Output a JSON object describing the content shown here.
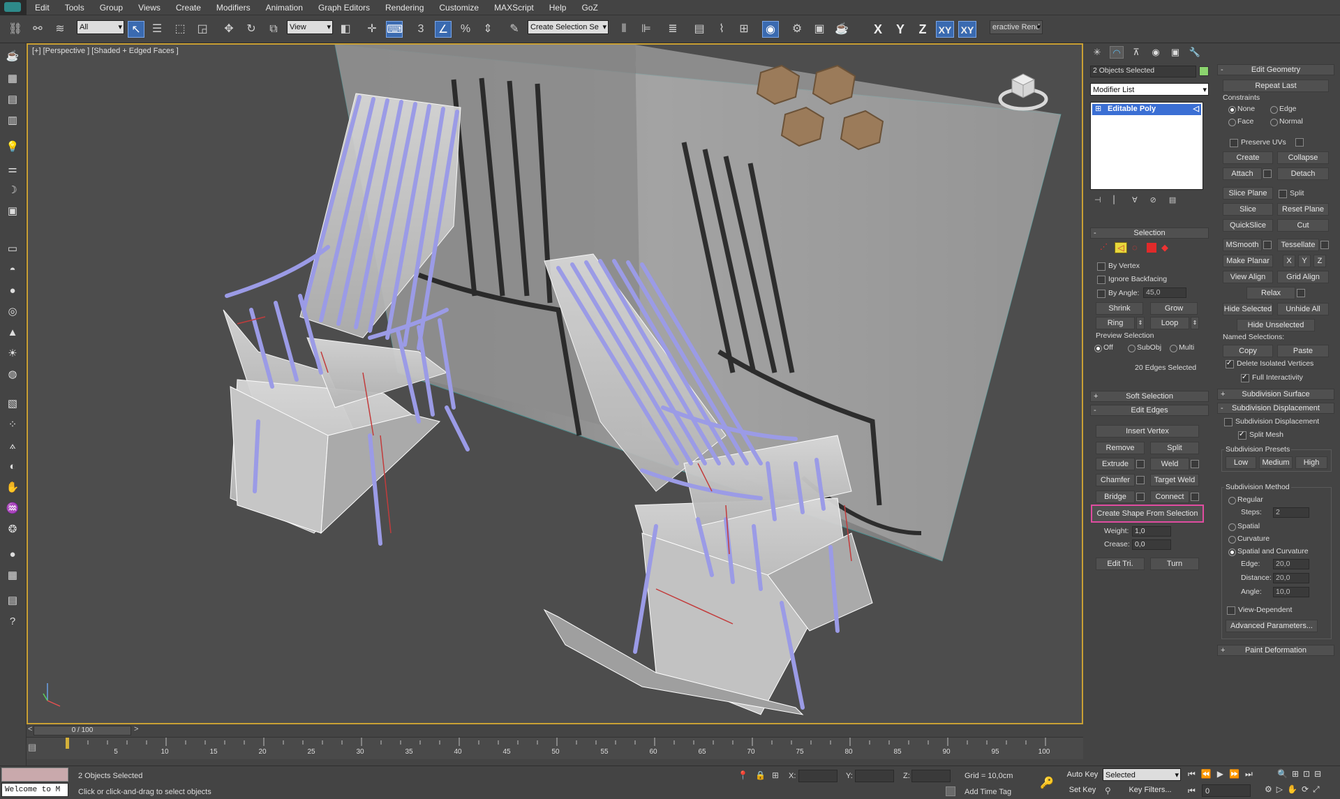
{
  "menu": [
    "Edit",
    "Tools",
    "Group",
    "Views",
    "Create",
    "Modifiers",
    "Animation",
    "Graph Editors",
    "Rendering",
    "Customize",
    "MAXScript",
    "Help",
    "GoZ"
  ],
  "toolbar": {
    "filter_select": "All",
    "refcoord_select": "View",
    "named_selection_select": "Create Selection Se",
    "interactive_render": "eractive Rend",
    "axes": [
      "X",
      "Y",
      "Z",
      "XY",
      "XY"
    ]
  },
  "viewport": {
    "label": "[+] [Perspective ] [Shaded + Edged Faces ]",
    "frame_range": "0 / 100"
  },
  "timeline": {
    "ticks": [
      "5",
      "10",
      "15",
      "20",
      "25",
      "30",
      "35",
      "40",
      "45",
      "50",
      "55",
      "60",
      "65",
      "70",
      "75",
      "80",
      "85",
      "90",
      "95",
      "100"
    ]
  },
  "status": {
    "maxscript_listener": "Welcome to M",
    "selection_info": "2 Objects Selected",
    "prompt": "Click or click-and-drag to select objects",
    "x_label": "X:",
    "y_label": "Y:",
    "z_label": "Z:",
    "grid": "Grid = 10,0cm",
    "add_time_tag": "Add Time Tag",
    "auto_key": "Auto Key",
    "set_key": "Set Key",
    "key_mode": "Selected",
    "key_filters": "Key Filters...",
    "frame": "0"
  },
  "command_panel": {
    "objects_selected": "2 Objects Selected",
    "modifier_list": "Modifier List",
    "stack_item": "Editable Poly",
    "selection": {
      "title": "Selection",
      "by_vertex": "By Vertex",
      "ignore_backfacing": "Ignore Backfacing",
      "by_angle": "By Angle:",
      "angle_value": "45,0",
      "shrink": "Shrink",
      "grow": "Grow",
      "ring": "Ring",
      "loop": "Loop",
      "preview_selection": "Preview Selection",
      "off": "Off",
      "subobj": "SubObj",
      "multi": "Multi",
      "status": "20 Edges Selected"
    },
    "soft_selection": "Soft Selection",
    "edit_edges": {
      "title": "Edit Edges",
      "insert_vertex": "Insert Vertex",
      "remove": "Remove",
      "split": "Split",
      "extrude": "Extrude",
      "weld": "Weld",
      "chamfer": "Chamfer",
      "target_weld": "Target Weld",
      "bridge": "Bridge",
      "connect": "Connect",
      "create_shape": "Create Shape From Selection",
      "weight": "Weight:",
      "weight_value": "1,0",
      "crease": "Crease:",
      "crease_value": "0,0",
      "edit_tri": "Edit Tri.",
      "turn": "Turn"
    },
    "edit_geometry": {
      "title": "Edit Geometry",
      "repeat_last": "Repeat Last",
      "constraints": "Constraints",
      "none": "None",
      "edge": "Edge",
      "face": "Face",
      "normal": "Normal",
      "preserve_uvs": "Preserve UVs",
      "create": "Create",
      "collapse": "Collapse",
      "attach": "Attach",
      "detach": "Detach",
      "slice_plane": "Slice Plane",
      "split": "Split",
      "slice": "Slice",
      "reset_plane": "Reset Plane",
      "quickslice": "QuickSlice",
      "cut": "Cut",
      "msmooth": "MSmooth",
      "tessellate": "Tessellate",
      "make_planar": "Make Planar",
      "x": "X",
      "y": "Y",
      "z": "Z",
      "view_align": "View Align",
      "grid_align": "Grid Align",
      "relax": "Relax",
      "hide_selected": "Hide Selected",
      "unhide_all": "Unhide All",
      "hide_unselected": "Hide Unselected",
      "named_selections": "Named Selections:",
      "copy": "Copy",
      "paste": "Paste",
      "delete_isolated": "Delete Isolated Vertices",
      "full_interactivity": "Full Interactivity"
    },
    "subdivision_surface": "Subdivision Surface",
    "subdivision_displacement": {
      "title": "Subdivision Displacement",
      "subdivision_displacement": "Subdivision Displacement",
      "split_mesh": "Split Mesh",
      "presets": "Subdivision Presets",
      "low": "Low",
      "medium": "Medium",
      "high": "High",
      "method": "Subdivision Method",
      "regular": "Regular",
      "steps": "Steps:",
      "steps_value": "2",
      "spatial": "Spatial",
      "curvature": "Curvature",
      "spatial_curvature": "Spatial and Curvature",
      "edge": "Edge:",
      "edge_value": "20,0",
      "distance": "Distance:",
      "distance_value": "20,0",
      "angle": "Angle:",
      "angle_value": "10,0",
      "view_dependent": "View-Dependent",
      "advanced": "Advanced Parameters..."
    },
    "paint_deformation": "Paint Deformation"
  }
}
